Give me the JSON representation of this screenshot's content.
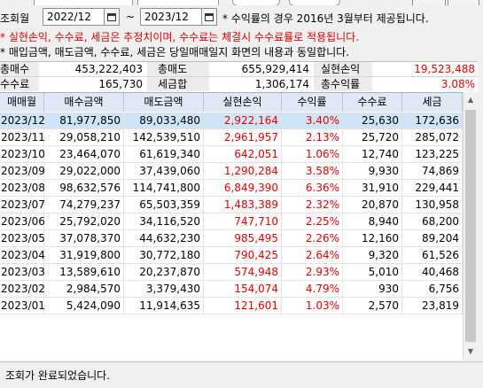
{
  "filters": {
    "period_label": "조회월",
    "from_month": "2022/12",
    "to_month": "2023/12",
    "range_sep": "~",
    "hint": "* 수익률의 경우 2016년 3월부터 제공됩니다."
  },
  "notes": {
    "warning": "* 실현손익, 수수료, 세금은 추정치이며, 수수료는 체결시 수수료률로 적용됩니다.",
    "info": "* 매입금액, 매도금액, 수수료, 세금은 당일매매일지 화면의 내용과 동일합니다."
  },
  "summary": {
    "total_buy_label": "총매수",
    "total_buy": "453,222,403",
    "total_sell_label": "총매도",
    "total_sell": "655,929,414",
    "realized_label": "실현손익",
    "realized": "19,523,488",
    "fee_label": "수수료",
    "fee": "165,730",
    "tax_label": "세금합",
    "tax": "1,306,174",
    "total_return_label": "총수익률",
    "total_return": "3.08%"
  },
  "table": {
    "headers": [
      "매매월",
      "매수금액",
      "매도금액",
      "실현손익",
      "수익률",
      "수수료",
      "세금"
    ],
    "rows": [
      [
        "2023/12",
        "81,977,850",
        "89,033,480",
        "2,922,164",
        "3.40%",
        "25,630",
        "172,636"
      ],
      [
        "2023/11",
        "29,058,210",
        "142,539,510",
        "2,961,957",
        "2.13%",
        "25,720",
        "285,072"
      ],
      [
        "2023/10",
        "23,464,070",
        "61,619,340",
        "642,051",
        "1.06%",
        "12,740",
        "123,225"
      ],
      [
        "2023/09",
        "29,022,000",
        "37,439,060",
        "1,290,284",
        "3.58%",
        "9,930",
        "74,869"
      ],
      [
        "2023/08",
        "98,632,576",
        "114,741,800",
        "6,849,390",
        "6.36%",
        "31,910",
        "229,441"
      ],
      [
        "2023/07",
        "74,279,237",
        "65,503,359",
        "1,483,389",
        "2.32%",
        "20,870",
        "130,958"
      ],
      [
        "2023/06",
        "25,792,020",
        "34,116,520",
        "747,710",
        "2.25%",
        "8,940",
        "68,200"
      ],
      [
        "2023/05",
        "37,078,370",
        "44,632,230",
        "985,495",
        "2.26%",
        "12,160",
        "89,204"
      ],
      [
        "2023/04",
        "31,919,800",
        "30,772,180",
        "790,425",
        "2.64%",
        "9,320",
        "61,526"
      ],
      [
        "2023/03",
        "13,589,610",
        "20,237,870",
        "574,948",
        "2.93%",
        "5,010",
        "40,468"
      ],
      [
        "2023/02",
        "2,984,570",
        "3,379,430",
        "154,074",
        "4.79%",
        "930",
        "6,756"
      ],
      [
        "2023/01",
        "5,424,090",
        "11,914,635",
        "121,601",
        "1.03%",
        "2,570",
        "23,819"
      ]
    ]
  },
  "status": {
    "message": "조회가 완료되었습니다."
  },
  "colors": {
    "profit": "#e00000",
    "selected_row": "#cfe4f7",
    "header_bg": "#dfe8f4"
  }
}
